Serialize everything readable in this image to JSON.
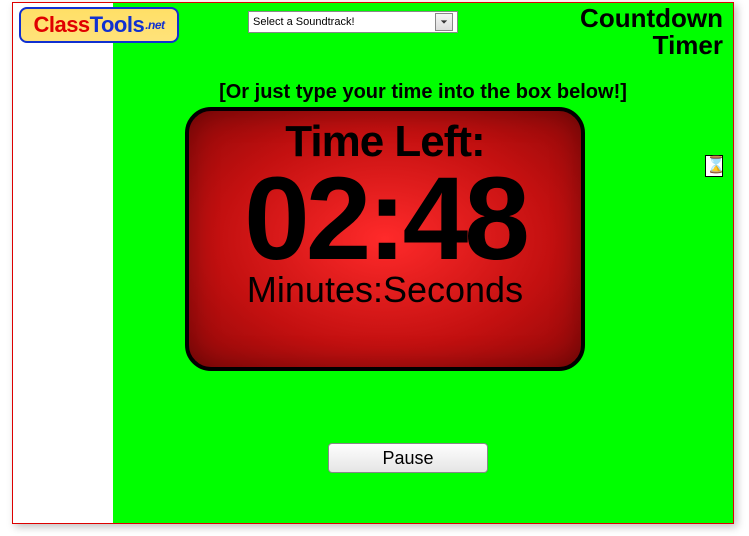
{
  "logo": {
    "part1": "Class",
    "part2": "Tools",
    "suffix": ".net"
  },
  "soundtrack": {
    "placeholder": "Select a Soundtrack!"
  },
  "app_title": {
    "line1": "Countdown",
    "line2": "Timer"
  },
  "instruction": "[Or just type your time into the box below!]",
  "timer": {
    "heading": "Time Left:",
    "value": "02:48",
    "units": "Minutes:Seconds"
  },
  "controls": {
    "pause_label": "Pause"
  },
  "cursor_glyph": "⌛"
}
